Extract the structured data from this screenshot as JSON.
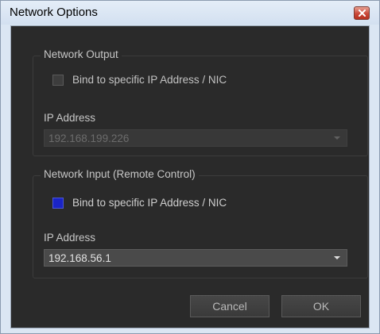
{
  "window": {
    "title": "Network Options"
  },
  "network_output": {
    "legend": "Network Output",
    "bind_label": "Bind to specific IP Address / NIC",
    "bind_checked": false,
    "ip_label": "IP Address",
    "ip_value": "192.168.199.226",
    "ip_enabled": false
  },
  "network_input": {
    "legend": "Network Input (Remote Control)",
    "bind_label": "Bind to specific IP Address / NIC",
    "bind_checked": true,
    "ip_label": "IP Address",
    "ip_value": "192.168.56.1",
    "ip_enabled": true
  },
  "buttons": {
    "cancel_label": "Cancel",
    "ok_label": "OK"
  },
  "colors": {
    "client_background": "#2a2a2a",
    "checkbox_checked": "#1a24c6",
    "close_button": "#c9493a"
  },
  "icons": {
    "close": "close-icon",
    "dropdown": "chevron-down-icon"
  }
}
